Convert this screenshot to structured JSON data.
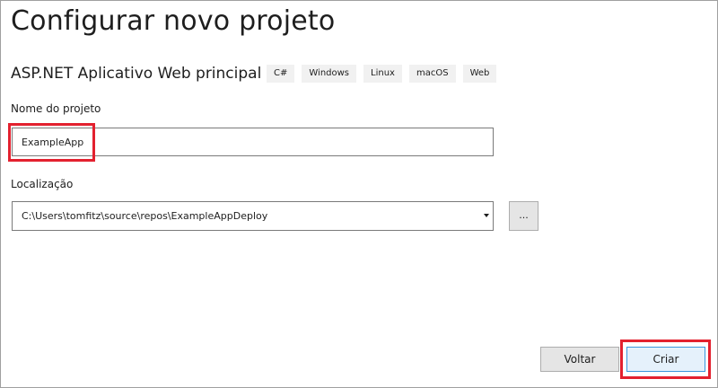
{
  "page": {
    "title": "Configurar novo projeto"
  },
  "template": {
    "name": "ASP.NET Aplicativo Web principal",
    "tags": [
      "C#",
      "Windows",
      "Linux",
      "macOS",
      "Web"
    ]
  },
  "project_name": {
    "label": "Nome do projeto",
    "value": "ExampleApp"
  },
  "location": {
    "label": "Localização",
    "value": "C:\\Users\\tomfitz\\source\\repos\\ExampleAppDeploy",
    "browse_label": "..."
  },
  "footer": {
    "back_label": "Voltar",
    "create_label": "Criar"
  },
  "colors": {
    "highlight": "#e3212f",
    "primary_border": "#3a96dd",
    "tag_background": "#f1f1f1"
  }
}
